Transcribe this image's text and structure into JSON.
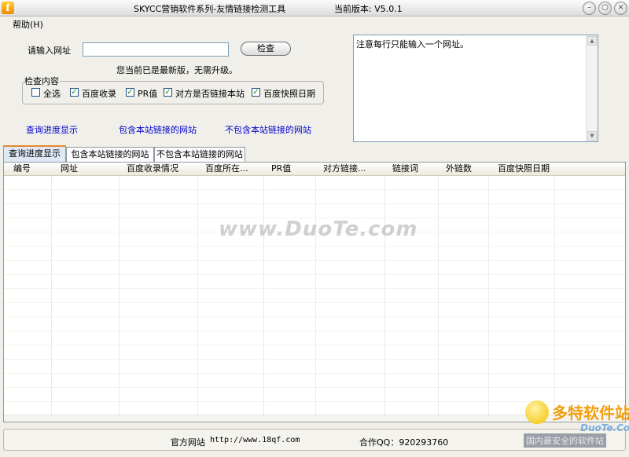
{
  "window": {
    "title": "SKYCC营销软件系列-友情链接检测工具",
    "version_label": "当前版本: V5.0.1",
    "app_icon_glyph": "f",
    "controls": {
      "minimize": "–",
      "maximize": "○",
      "close": "×"
    }
  },
  "menu": {
    "help": "帮助(H)"
  },
  "form": {
    "url_label": "请输入网址",
    "url_value": "",
    "check_button": "检查",
    "update_status": "您当前已是最新版，无需升级。"
  },
  "options": {
    "legend": "检查内容",
    "items": [
      {
        "label": "全选",
        "checked": false
      },
      {
        "label": "百度收录",
        "checked": true
      },
      {
        "label": "PR值",
        "checked": true
      },
      {
        "label": "对方是否链接本站",
        "checked": true
      },
      {
        "label": "百度快照日期",
        "checked": true
      }
    ]
  },
  "links": {
    "progress": "查询进度显示",
    "contains": "包含本站链接的网站",
    "not_contains": "不包含本站链接的网站"
  },
  "notes": {
    "text": "注意每行只能输入一个网址。"
  },
  "tabs": [
    {
      "label": "查询进度显示",
      "active": true
    },
    {
      "label": "包含本站链接的网站",
      "active": false
    },
    {
      "label": "不包含本站链接的网站",
      "active": false
    }
  ],
  "table": {
    "columns": [
      "编号",
      "网址",
      "百度收录情况",
      "百度所在...",
      "PR值",
      "对方链接...",
      "链接词",
      "外链数",
      "百度快照日期"
    ],
    "rows": []
  },
  "status": {
    "website_label": "官方网站",
    "website_url": "http://www.18qf.com",
    "qq_label": "合作QQ：920293760"
  },
  "watermark": {
    "text": "www.DuoTe.com",
    "logo_cn": "多特软件站",
    "logo_en": "DuoTe.Com",
    "logo_slogan": "国内最安全的软件站"
  },
  "colors": {
    "link": "#0000cc",
    "tab_active_accent": "#e68b2c",
    "check_mark": "#1a8a1a"
  }
}
